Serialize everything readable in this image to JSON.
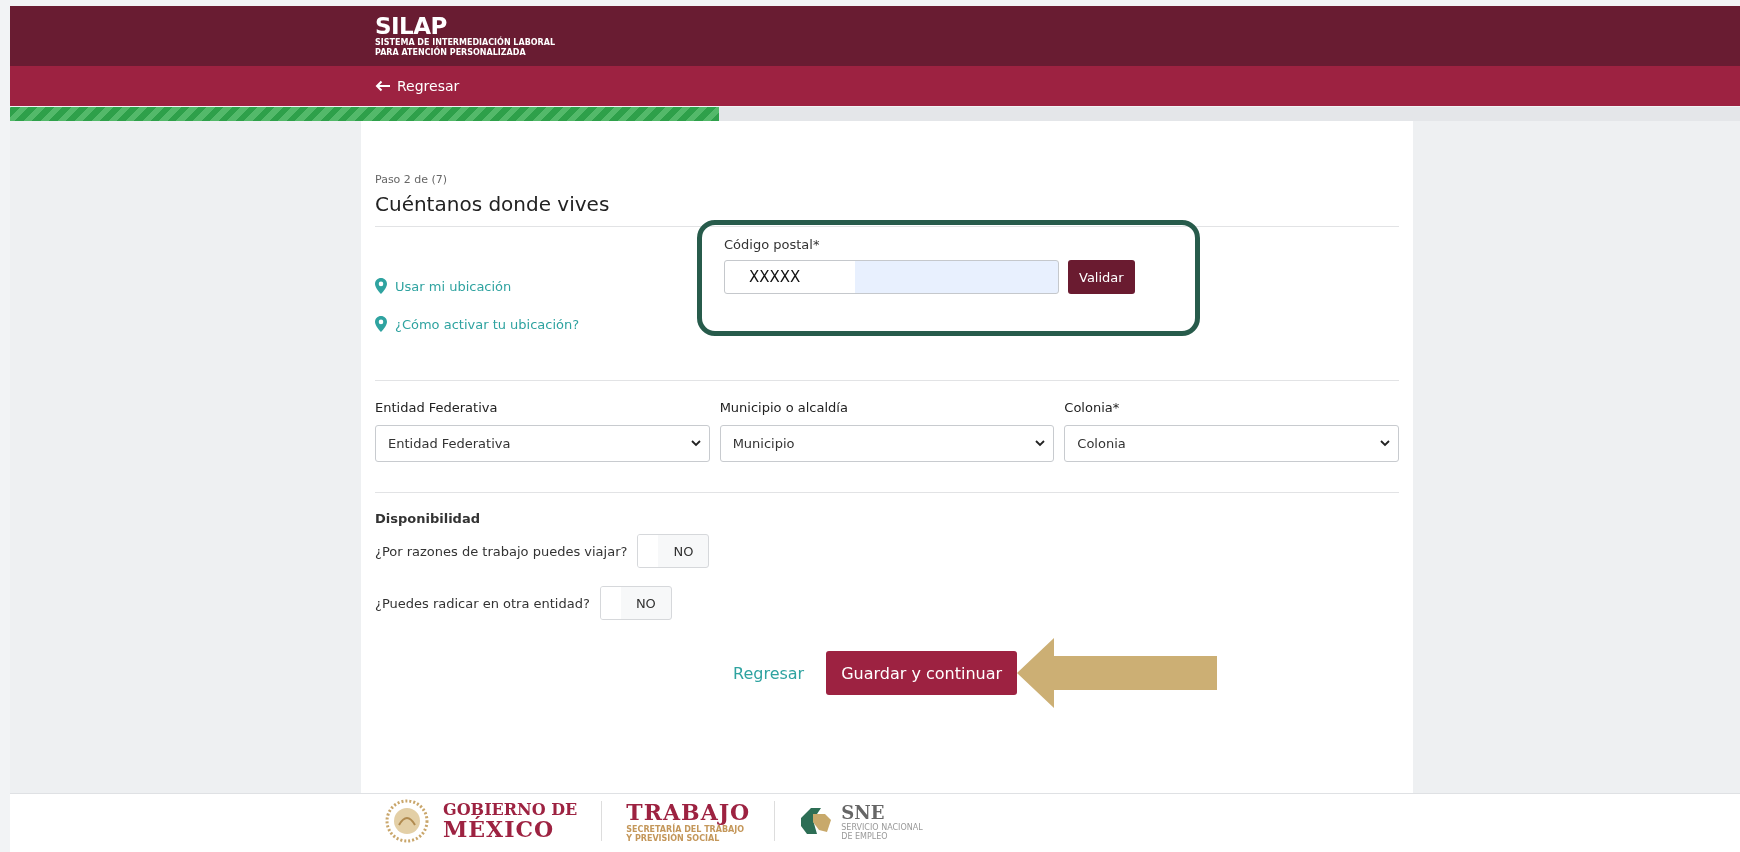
{
  "header": {
    "logo_title": "SILAP",
    "logo_subtitle": [
      "SISTEMA DE INTERMEDIACIÓN LABORAL",
      "PARA ATENCIÓN PERSONALIZADA"
    ],
    "back_link": "Regresar"
  },
  "progress": {
    "level": 0.41
  },
  "form": {
    "step": "Paso 2 de (7)",
    "title": "Cuéntanos donde vives",
    "location_links": [
      "Usar mi ubicación",
      "¿Cómo activar tu ubicación?"
    ],
    "postal_code": {
      "label": "Código postal*",
      "value": "XXXXX",
      "button": "Validar"
    },
    "selects": [
      {
        "label": "Entidad Federativa",
        "value": "Entidad Federativa"
      },
      {
        "label": "Municipio o alcaldía",
        "value": "Municipio"
      },
      {
        "label": "Colonia*",
        "value": "Colonia"
      }
    ],
    "availability": {
      "heading": "Disponibilidad",
      "questions": [
        {
          "label": "¿Por razones de trabajo puedes viajar?",
          "toggle": "NO",
          "on": false
        },
        {
          "label": "¿Puedes radicar en otra entidad?",
          "toggle": "NO",
          "on": false
        }
      ]
    },
    "actions": {
      "back": "Regresar",
      "submit": "Guardar y continuar"
    }
  },
  "footer": {
    "gobierno": [
      "GOBIERNO DE",
      "MÉXICO"
    ],
    "trabajo": {
      "title": "TRABAJO",
      "subtitle": [
        "SECRETARÍA DEL TRABAJO",
        "Y PREVISIÓN SOCIAL"
      ]
    },
    "sne": {
      "title": "SNE",
      "subtitle": [
        "SERVICIO NACIONAL",
        "DE EMPLEO"
      ]
    }
  }
}
